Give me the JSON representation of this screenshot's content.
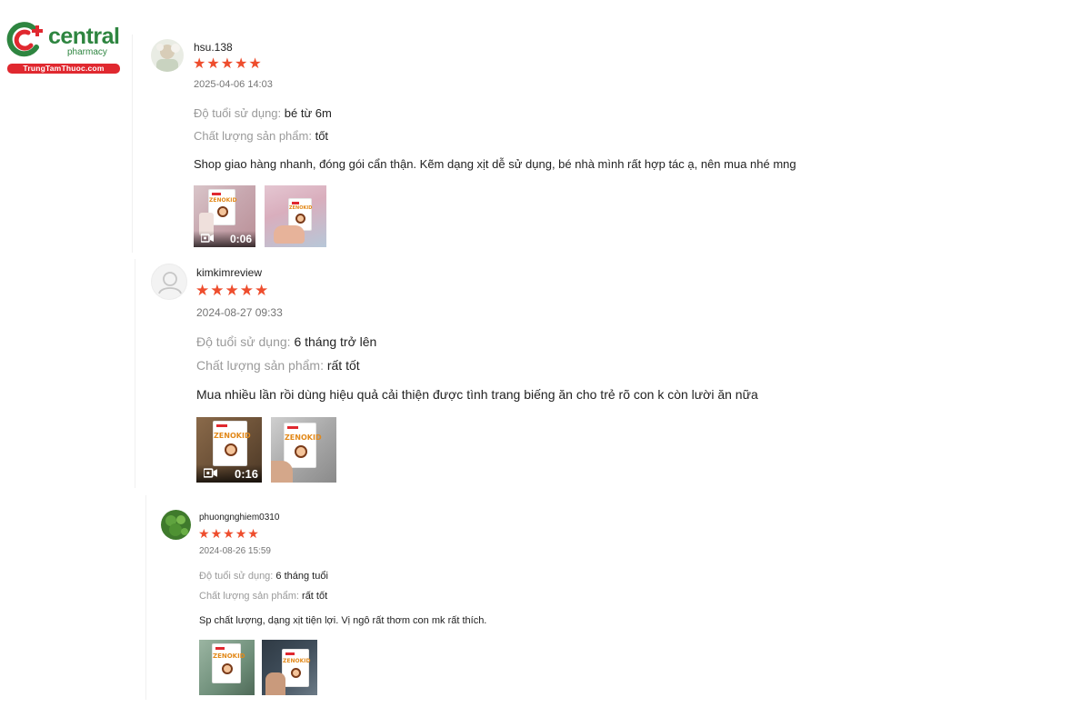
{
  "logo": {
    "title": "central",
    "subtitle": "pharmacy",
    "url": "TrungTamThuoc.com",
    "colors": {
      "green": "#2e8540",
      "red": "#e0282f"
    }
  },
  "reviews": [
    {
      "username": "hsu.138",
      "rating": 5,
      "time": "2025-04-06 14:03",
      "age_label": "Độ tuổi sử dụng:",
      "age_value": "bé từ 6m",
      "quality_label": "Chất lượng sản phẩm:",
      "quality_value": "tốt",
      "comment": "Shop giao hàng nhanh, đóng gói cẩn thận. Kẽm dạng xịt dễ sử dụng, bé nhà mình rất hợp tác ạ, nên mua nhé mng",
      "media": [
        {
          "type": "video",
          "duration": "0:06"
        },
        {
          "type": "image"
        }
      ]
    },
    {
      "username": "kimkimreview",
      "rating": 5,
      "time": "2024-08-27 09:33",
      "age_label": "Độ tuổi sử dụng:",
      "age_value": "6 tháng trở lên",
      "quality_label": "Chất lượng sản phẩm:",
      "quality_value": "rất tốt",
      "comment": "Mua nhiều lần rồi dùng hiệu quả cải thiện được tình trang biếng ăn cho trẻ rõ con k còn lười ăn nữa",
      "media": [
        {
          "type": "video",
          "duration": "0:16"
        },
        {
          "type": "image"
        }
      ]
    },
    {
      "username": "phuongnghiem0310",
      "rating": 5,
      "time": "2024-08-26 15:59",
      "age_label": "Độ tuổi sử dụng:",
      "age_value": "6 tháng tuổi",
      "quality_label": "Chất lượng sản phẩm:",
      "quality_value": "rất tốt",
      "comment": "Sp chất lượng, dạng xịt tiện lợi. Vị ngô rất thơm con mk rất thích.",
      "media": [
        {
          "type": "image"
        },
        {
          "type": "image"
        }
      ]
    }
  ],
  "product_brand": "ZENOKID",
  "star_color": "#ee4d2d",
  "icons": {
    "star": "star-icon",
    "video": "video-camera-icon",
    "avatar_default": "user-placeholder-icon"
  }
}
